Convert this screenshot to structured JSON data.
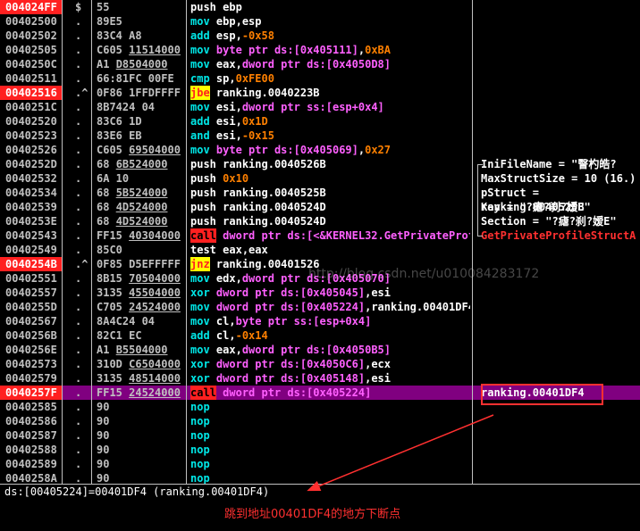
{
  "rows": [
    {
      "addr": "004024FF",
      "mark": "$",
      "hex": [
        "55"
      ],
      "mn": "push",
      "mnc": "plain",
      "ops": [
        [
          "ebp",
          ""
        ]
      ],
      "bp": true
    },
    {
      "addr": "00402500",
      "mark": ".",
      "hex": [
        "89E5"
      ],
      "mn": "mov",
      "ops": [
        [
          "ebp,esp",
          ""
        ]
      ]
    },
    {
      "addr": "00402502",
      "mark": ".",
      "hex": [
        "83C4 A8"
      ],
      "mn": "add",
      "ops": [
        [
          "esp,",
          ""
        ],
        [
          "-0x58",
          "imm"
        ]
      ]
    },
    {
      "addr": "00402505",
      "mark": ".",
      "hex": [
        "C605 ",
        "11514000"
      ],
      "mn": "mov",
      "ops": [
        [
          "byte ptr ds:[0x405111]",
          "mem"
        ],
        [
          ",",
          ""
        ],
        [
          "0xBA",
          "imm"
        ]
      ]
    },
    {
      "addr": "0040250C",
      "mark": ".",
      "hex": [
        "A1 ",
        "D8504000"
      ],
      "mn": "mov",
      "ops": [
        [
          "eax,",
          ""
        ],
        [
          "dword ptr ds:[0x4050D8]",
          "mem"
        ]
      ]
    },
    {
      "addr": "00402511",
      "mark": ".",
      "hex": [
        "66:81FC 00FE"
      ],
      "mn": "cmp",
      "ops": [
        [
          "sp,",
          ""
        ],
        [
          "0xFE00",
          "imm"
        ]
      ]
    },
    {
      "addr": "00402516",
      "mark": ".^",
      "hex": [
        "0F86 1FFDFFFF"
      ],
      "mn": "jbe",
      "mnc": "jcc",
      "ops": [
        [
          "ranking.0040223B",
          "ret"
        ]
      ],
      "bp": true
    },
    {
      "addr": "0040251C",
      "mark": ".",
      "hex": [
        "8B7424 04"
      ],
      "mn": "mov",
      "ops": [
        [
          "esi,",
          ""
        ],
        [
          "dword ptr ss:[esp+0x4]",
          "mem"
        ]
      ]
    },
    {
      "addr": "00402520",
      "mark": ".",
      "hex": [
        "83C6 1D"
      ],
      "mn": "add",
      "ops": [
        [
          "esi,",
          ""
        ],
        [
          "0x1D",
          "imm"
        ]
      ]
    },
    {
      "addr": "00402523",
      "mark": ".",
      "hex": [
        "83E6 EB"
      ],
      "mn": "and",
      "ops": [
        [
          "esi,",
          ""
        ],
        [
          "-0x15",
          "imm"
        ]
      ]
    },
    {
      "addr": "00402526",
      "mark": ".",
      "hex": [
        "C605 ",
        "69504000"
      ],
      "mn": "mov",
      "ops": [
        [
          "byte ptr ds:[0x405069]",
          "mem"
        ],
        [
          ",",
          ""
        ],
        [
          "0x27",
          "imm"
        ]
      ]
    },
    {
      "addr": "0040252D",
      "mark": ".",
      "hex": [
        "68 ",
        "6B524000"
      ],
      "mn": "push",
      "mnc": "jmp",
      "ops": [
        [
          "ranking.0040526B",
          "ret"
        ]
      ]
    },
    {
      "addr": "00402532",
      "mark": ".",
      "hex": [
        "6A 10"
      ],
      "mn": "push",
      "mnc": "jmp",
      "ops": [
        [
          "0x10",
          "imm"
        ]
      ]
    },
    {
      "addr": "00402534",
      "mark": ".",
      "hex": [
        "68 ",
        "5B524000"
      ],
      "mn": "push",
      "mnc": "jmp",
      "ops": [
        [
          "ranking.0040525B",
          "ret"
        ]
      ]
    },
    {
      "addr": "00402539",
      "mark": ".",
      "hex": [
        "68 ",
        "4D524000"
      ],
      "mn": "push",
      "mnc": "jmp",
      "ops": [
        [
          "ranking.0040524D",
          "ret"
        ]
      ]
    },
    {
      "addr": "0040253E",
      "mark": ".",
      "hex": [
        "68 ",
        "4D524000"
      ],
      "mn": "push",
      "mnc": "jmp",
      "ops": [
        [
          "ranking.0040524D",
          "ret"
        ]
      ]
    },
    {
      "addr": "00402543",
      "mark": ".",
      "hex": [
        "FF15 ",
        "40304000"
      ],
      "mn": "call",
      "mnc": "call",
      "ops": [
        [
          "dword ptr ds:[<&KERNEL32.GetPrivateProfileStructA>]",
          "mem"
        ]
      ]
    },
    {
      "addr": "00402549",
      "mark": ".",
      "hex": [
        "85C0"
      ],
      "mn": "test",
      "mnc": "plain",
      "ops": [
        [
          "eax,eax",
          ""
        ]
      ]
    },
    {
      "addr": "0040254B",
      "mark": ".^",
      "hex": [
        "0F85 D5EFFFFF"
      ],
      "mn": "jnz",
      "mnc": "jcc",
      "ops": [
        [
          "ranking.00401526",
          "ret"
        ]
      ],
      "bp": true
    },
    {
      "addr": "00402551",
      "mark": ".",
      "hex": [
        "8B15 ",
        "70504000"
      ],
      "mn": "mov",
      "ops": [
        [
          "edx,",
          ""
        ],
        [
          "dword ptr ds:[0x405070]",
          "mem"
        ]
      ]
    },
    {
      "addr": "00402557",
      "mark": ".",
      "hex": [
        "3135 ",
        "45504000"
      ],
      "mn": "xor",
      "ops": [
        [
          "dword ptr ds:[0x405045]",
          "mem"
        ],
        [
          ",esi",
          ""
        ]
      ]
    },
    {
      "addr": "0040255D",
      "mark": ".",
      "hex": [
        "C705 ",
        "24524000"
      ],
      "mn": "mov",
      "ops": [
        [
          "dword ptr ds:[0x405224]",
          "mem"
        ],
        [
          ",ranking.00401DF4",
          ""
        ]
      ]
    },
    {
      "addr": "00402567",
      "mark": ".",
      "hex": [
        "8A4C24 04"
      ],
      "mn": "mov",
      "ops": [
        [
          "cl,",
          ""
        ],
        [
          "byte ptr ss:[esp+0x4]",
          "mem"
        ]
      ]
    },
    {
      "addr": "0040256B",
      "mark": ".",
      "hex": [
        "82C1 EC"
      ],
      "mn": "add",
      "ops": [
        [
          "cl,",
          ""
        ],
        [
          "-0x14",
          "imm"
        ]
      ]
    },
    {
      "addr": "0040256E",
      "mark": ".",
      "hex": [
        "A1 ",
        "B5504000"
      ],
      "mn": "mov",
      "ops": [
        [
          "eax,",
          ""
        ],
        [
          "dword ptr ds:[0x4050B5]",
          "mem"
        ]
      ]
    },
    {
      "addr": "00402573",
      "mark": ".",
      "hex": [
        "310D ",
        "C6504000"
      ],
      "mn": "xor",
      "ops": [
        [
          "dword ptr ds:[0x4050C6]",
          "mem"
        ],
        [
          ",ecx",
          ""
        ]
      ]
    },
    {
      "addr": "00402579",
      "mark": ".",
      "hex": [
        "3135 ",
        "48514000"
      ],
      "mn": "xor",
      "ops": [
        [
          "dword ptr ds:[0x405148]",
          "mem"
        ],
        [
          ",esi",
          ""
        ]
      ]
    },
    {
      "addr": "0040257F",
      "mark": ".",
      "hex": [
        "FF15 ",
        "24524000"
      ],
      "mn": "call",
      "mnc": "call",
      "ops": [
        [
          "dword ptr ds:[0x405224]",
          "mem"
        ]
      ],
      "sel": true,
      "bp": true
    },
    {
      "addr": "00402585",
      "mark": ".",
      "hex": [
        "90"
      ],
      "mn": "nop",
      "ops": []
    },
    {
      "addr": "00402586",
      "mark": ".",
      "hex": [
        "90"
      ],
      "mn": "nop",
      "ops": []
    },
    {
      "addr": "00402587",
      "mark": ".",
      "hex": [
        "90"
      ],
      "mn": "nop",
      "ops": []
    },
    {
      "addr": "00402588",
      "mark": ".",
      "hex": [
        "90"
      ],
      "mn": "nop",
      "ops": []
    },
    {
      "addr": "00402589",
      "mark": ".",
      "hex": [
        "90"
      ],
      "mn": "nop",
      "ops": []
    },
    {
      "addr": "0040258A",
      "mark": ".",
      "hex": [
        "90"
      ],
      "mn": "nop",
      "ops": []
    }
  ],
  "comments": [
    {
      "row": 11,
      "text": "IniFileName = \"瞖杓皓?",
      "bracket": "top"
    },
    {
      "row": 12,
      "text": "MaxStructSize = 10 (16.)",
      "bracket": "mid"
    },
    {
      "row": 13,
      "text": "pStruct = ranking.0040525B",
      "bracket": "mid"
    },
    {
      "row": 14,
      "text": "Key = \"?瘧?刹?嫒E\"",
      "bracket": "mid"
    },
    {
      "row": 15,
      "text": "Section = \"?瘧?刹?嫒E\"",
      "bracket": "mid"
    },
    {
      "row": 16,
      "text": "GetPrivateProfileStructA",
      "bracket": "bot",
      "red": true
    },
    {
      "row": 27,
      "text": "ranking.00401DF4",
      "bracket": ""
    }
  ],
  "info_line": "ds:[00405224]=00401DF4 (ranking.00401DF4)",
  "note": "跳到地址00401DF4的地方下断点",
  "watermark": "http://blog.csdn.net/u010084283172",
  "colors": {
    "breakpoint": "#ff2020",
    "selection": "#800080",
    "annotation": "#ff3030"
  }
}
